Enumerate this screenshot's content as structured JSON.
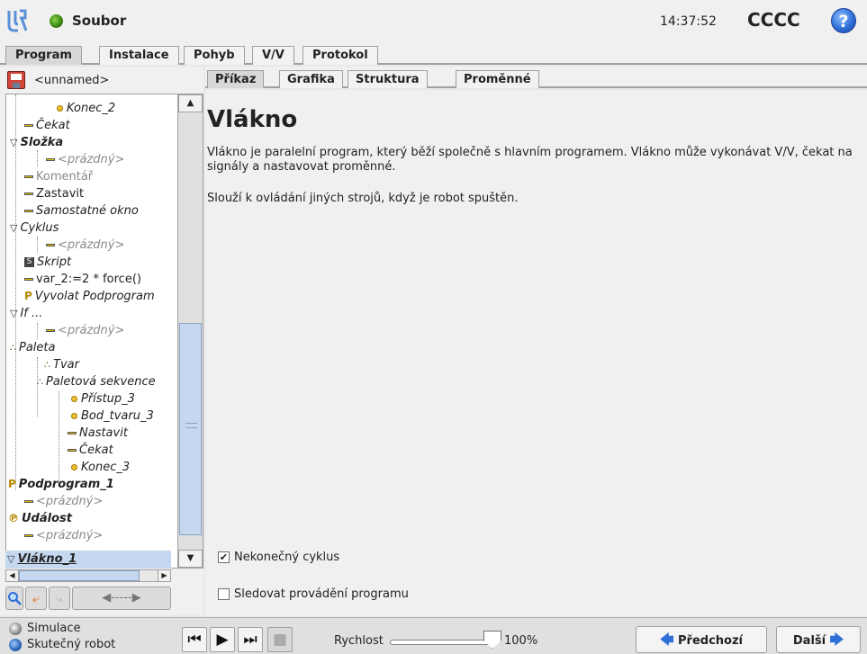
{
  "titlebar": {
    "file_label": "Soubor",
    "clock": "14:37:52",
    "robot_name": "CCCC",
    "help": "?"
  },
  "main_tabs": [
    "Program",
    "Instalace",
    "Pohyb",
    "V/V",
    "Protokol"
  ],
  "program": {
    "name": "<unnamed>"
  },
  "tree": {
    "items": [
      {
        "label": "Konec_2"
      },
      {
        "label": "Čekat"
      },
      {
        "label": "Složka"
      },
      {
        "label": "<prázdný>"
      },
      {
        "label": "Komentář"
      },
      {
        "label": "Zastavit"
      },
      {
        "label": "Samostatné okno"
      },
      {
        "label": "Cyklus"
      },
      {
        "label": "<prázdný>"
      },
      {
        "label": "Skript"
      },
      {
        "label": "var_2:=2 * force()"
      },
      {
        "label": "Vyvolat Podprogram"
      },
      {
        "label": "If ..."
      },
      {
        "label": "<prázdný>"
      },
      {
        "label": "Paleta"
      },
      {
        "label": "Tvar"
      },
      {
        "label": "Paletová sekvence"
      },
      {
        "label": "Přístup_3"
      },
      {
        "label": "Bod_tvaru_3"
      },
      {
        "label": "Nastavit"
      },
      {
        "label": "Čekat"
      },
      {
        "label": "Konec_3"
      },
      {
        "label": "Podprogram_1"
      },
      {
        "label": "<prázdný>"
      },
      {
        "label": "Událost"
      },
      {
        "label": "<prázdný>"
      },
      {
        "label": "Vlákno_1"
      }
    ]
  },
  "sub_tabs": [
    "Příkaz",
    "Grafika",
    "Struktura",
    "Proměnné"
  ],
  "content": {
    "title": "Vlákno",
    "description": "Vlákno je paralelní program, který běží společně s hlavním programem. Vlákno může vykonávat V/V, čekat na signály a nastavovat proměnné.",
    "description2": "Slouží k ovládání jiných strojů, když je robot spuštěn.",
    "checkbox_infinite": {
      "label": "Nekonečný cyklus",
      "checked": true
    },
    "checkbox_follow": {
      "label": "Sledovat provádění programu",
      "checked": false
    }
  },
  "bottom": {
    "mode_sim": "Simulace",
    "mode_real": "Skutečný robot",
    "speed_label": "Rychlost",
    "speed_value": "100%",
    "speed_fraction": 1.0,
    "prev_label": "Předchozí",
    "next_label": "Další"
  },
  "colors": {
    "accent_blue": "#2f6fd8",
    "status_green": "#3d8a12",
    "selection_blue": "#c6d8f0"
  }
}
